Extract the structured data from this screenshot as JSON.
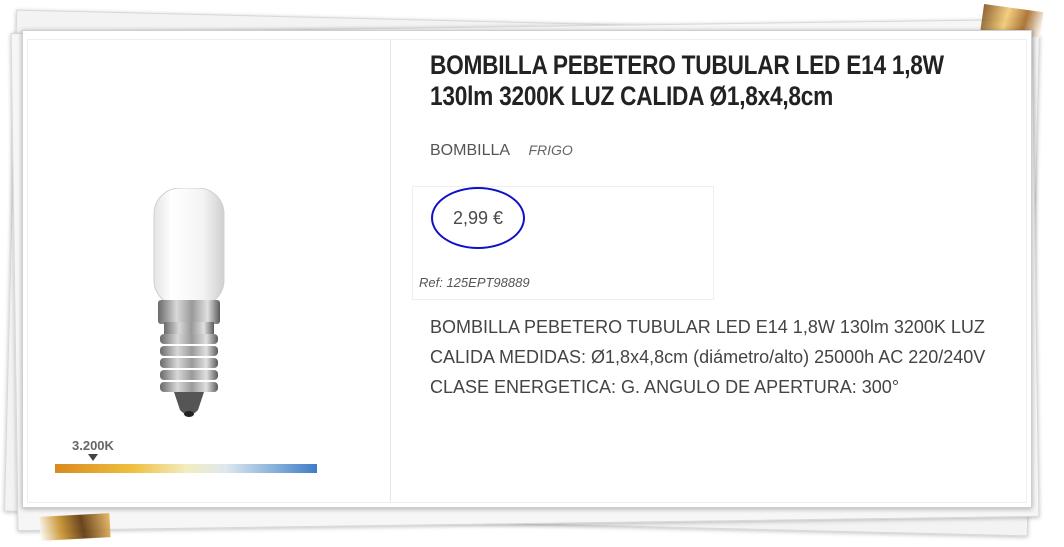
{
  "product": {
    "title": "BOMBILLA PEBETERO TUBULAR LED E14 1,8W 130lm 3200K LUZ CALIDA Ø1,8x4,8cm",
    "category": "BOMBILLA",
    "subcategory": "FRIGO",
    "price": "2,99 €",
    "reference": "Ref: 125EPT98889",
    "description": "BOMBILLA PEBETERO TUBULAR LED E14 1,8W 130lm 3200K LUZ CALIDA MEDIDAS: Ø1,8x4,8cm (diámetro/alto) 25000h AC 220/240V CLASE ENERGETICA: G. ANGULO DE APERTURA: 300°"
  },
  "image": {
    "color_temperature_label": "3.200K"
  },
  "colors": {
    "price_circle": "#1010c8",
    "text": "#444444"
  }
}
